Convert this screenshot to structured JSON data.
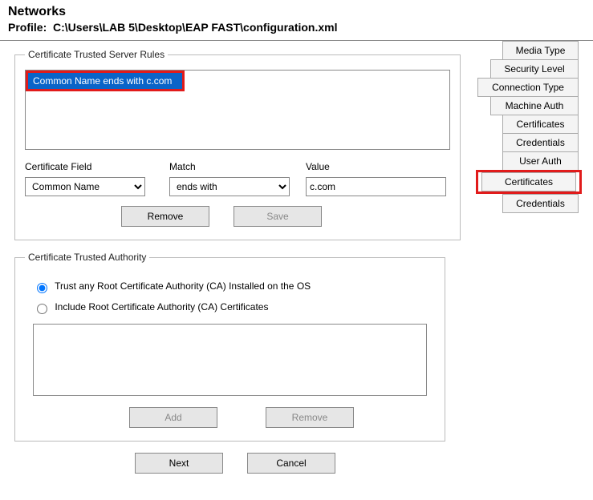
{
  "header": {
    "title": "Networks",
    "profile_label": "Profile:",
    "profile_path": "C:\\Users\\LAB 5\\Desktop\\EAP FAST\\configuration.xml"
  },
  "rules_section": {
    "legend": "Certificate Trusted Server Rules",
    "list_items": [
      "Common Name ends with c.com"
    ],
    "field_labels": {
      "cert_field": "Certificate Field",
      "match": "Match",
      "value": "Value"
    },
    "cert_field_selected": "Common Name",
    "match_selected": "ends with",
    "value_input": "c.com",
    "buttons": {
      "remove": "Remove",
      "save": "Save"
    }
  },
  "authority_section": {
    "legend": "Certificate Trusted Authority",
    "radio_any": "Trust any Root Certificate Authority (CA) Installed on the OS",
    "radio_include": "Include Root Certificate Authority (CA) Certificates",
    "radio_selected": "any",
    "buttons": {
      "add": "Add",
      "remove": "Remove"
    }
  },
  "bottom": {
    "next": "Next",
    "cancel": "Cancel"
  },
  "sidebar": {
    "tabs": [
      {
        "label": "Media Type",
        "width": "w1"
      },
      {
        "label": "Security Level",
        "width": "w2"
      },
      {
        "label": "Connection Type",
        "width": "w3"
      },
      {
        "label": "Machine Auth",
        "width": "w2"
      },
      {
        "label": "Certificates",
        "width": "w1"
      },
      {
        "label": "Credentials",
        "width": "w1"
      },
      {
        "label": "User Auth",
        "width": "w1"
      },
      {
        "label": "Certificates",
        "width": "w1",
        "highlight": true
      },
      {
        "label": "Credentials",
        "width": "w1"
      }
    ]
  }
}
